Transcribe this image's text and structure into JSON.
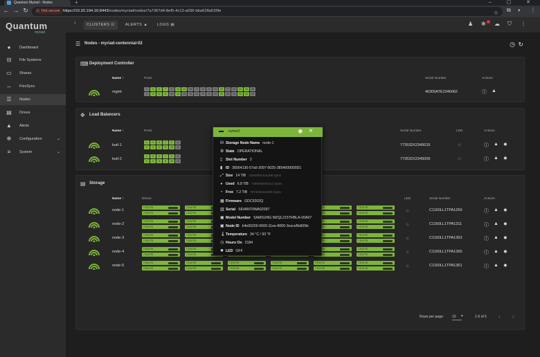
{
  "browser": {
    "tab_title": "Quantum Myriad - Nodes",
    "new_tab": "+",
    "not_secure": "Not secure",
    "url_host": "https://10.20.194.16:8443",
    "url_path": "/nodes/myriad/nodes/7a7367d4-8ef5-4c13-a036-bba628a535fe"
  },
  "sidebar": {
    "logo": "Quantum",
    "logo_sub": "myriad",
    "items": [
      {
        "label": "Dashboard",
        "icon": "info-icon"
      },
      {
        "label": "File Systems",
        "icon": "file-systems-icon"
      },
      {
        "label": "Shares",
        "icon": "shares-icon"
      },
      {
        "label": "FlexSync",
        "icon": "flexsync-icon"
      },
      {
        "label": "Nodes",
        "icon": "nodes-icon"
      },
      {
        "label": "Drives",
        "icon": "drives-icon"
      },
      {
        "label": "Alerts",
        "icon": "bell-icon"
      },
      {
        "label": "Configuration",
        "icon": "gear-icon"
      },
      {
        "label": "System",
        "icon": "system-icon"
      }
    ]
  },
  "header": {
    "clusters": "CLUSTERS",
    "alerts": "ALERTS",
    "logs": "LOGS"
  },
  "page": {
    "title": "Nodes - myriad-centennial-02"
  },
  "deployment": {
    "title": "Deployment Controller",
    "col_name": "Name ↑",
    "col_ports": "Ports",
    "col_serial": "Serial Number",
    "col_actions": "Actions",
    "row": {
      "name": "mgmt",
      "serial": "46305ATE2346062"
    },
    "ports_row1": [
      "1",
      "3",
      "5",
      "7",
      "9",
      "11",
      "13",
      "15",
      "17",
      "19",
      "21",
      "23",
      "25",
      "27",
      "29",
      "31",
      "33",
      "35"
    ],
    "ports_row2": [
      "2",
      "4",
      "6",
      "8",
      "10",
      "12",
      "14",
      "16",
      "18",
      "20",
      "22",
      "24",
      "26",
      "28",
      "30",
      "32",
      "34",
      "36"
    ]
  },
  "loadbalancers": {
    "title": "Load Balancers",
    "col_name": "Name ↑",
    "col_ports": "Ports",
    "col_serial": "Serial Number",
    "col_led": "LED",
    "col_actions": "Actions",
    "rows": [
      {
        "name": "leaf-1",
        "serial": "772632X2345015"
      },
      {
        "name": "leaf-2",
        "serial": "772632X2345009"
      }
    ]
  },
  "storage": {
    "title": "Storage",
    "col_name": "Name ↑",
    "col_drives": "Drives",
    "col_led": "LED",
    "col_serial": "Serial Number",
    "col_actions": "Actions",
    "rows": [
      {
        "name": "node-1",
        "serial": "C1160LL1TPA1269"
      },
      {
        "name": "node-2",
        "serial": "C1160LL1TPA1311"
      },
      {
        "name": "node-3",
        "serial": "C1160LL1TPA1363"
      },
      {
        "name": "node-4",
        "serial": "C1160LL1TPA1365"
      },
      {
        "name": "node-5",
        "serial": "C1160LL1TPA1361"
      }
    ],
    "drive_label": "7.2/14 TB",
    "rows_per_page_label": "Rows per page:",
    "rows_per_page": "10",
    "page_range": "1-5 of 5"
  },
  "popup": {
    "title": "nvme2",
    "fields": [
      {
        "label": "Storage Node Name",
        "value": "node-1",
        "sub": ""
      },
      {
        "label": "State",
        "value": "OPERATIONAL",
        "sub": ""
      },
      {
        "label": "Slot Number",
        "value": "2",
        "sub": ""
      },
      {
        "label": "ID",
        "value": "36564130-57a0-2097-0025-3854000000D1",
        "sub": ""
      },
      {
        "label": "Size",
        "value": "14 TiB",
        "sub": "15362991415296 bytes"
      },
      {
        "label": "Used",
        "value": "6.8 TiB",
        "sub": "7489066093312 bytes"
      },
      {
        "label": "Free",
        "value": "7.2 TiB",
        "sub": "7873925321984 bytes"
      },
      {
        "label": "Firmware",
        "value": "GDC5202Q",
        "sub": ""
      },
      {
        "label": "Serial",
        "value": "S6VANT0WA02097",
        "sub": ""
      },
      {
        "label": "Model Number",
        "value": "SAMSUNG MZQL215THBLA-00A07",
        "sub": ""
      },
      {
        "label": "Node ID",
        "value": "b4e90200-0600-11ee-8000-3cecef6d609c",
        "sub": ""
      },
      {
        "label": "Temperature",
        "value": "34 °C / 93 °F",
        "sub": ""
      },
      {
        "label": "Hours On",
        "value": "2184",
        "sub": ""
      },
      {
        "label": "LED",
        "value": "OFF",
        "sub": ""
      }
    ]
  },
  "colors": {
    "accent": "#7db53a",
    "port_off": "#777777",
    "background": "#1e1e1e"
  }
}
